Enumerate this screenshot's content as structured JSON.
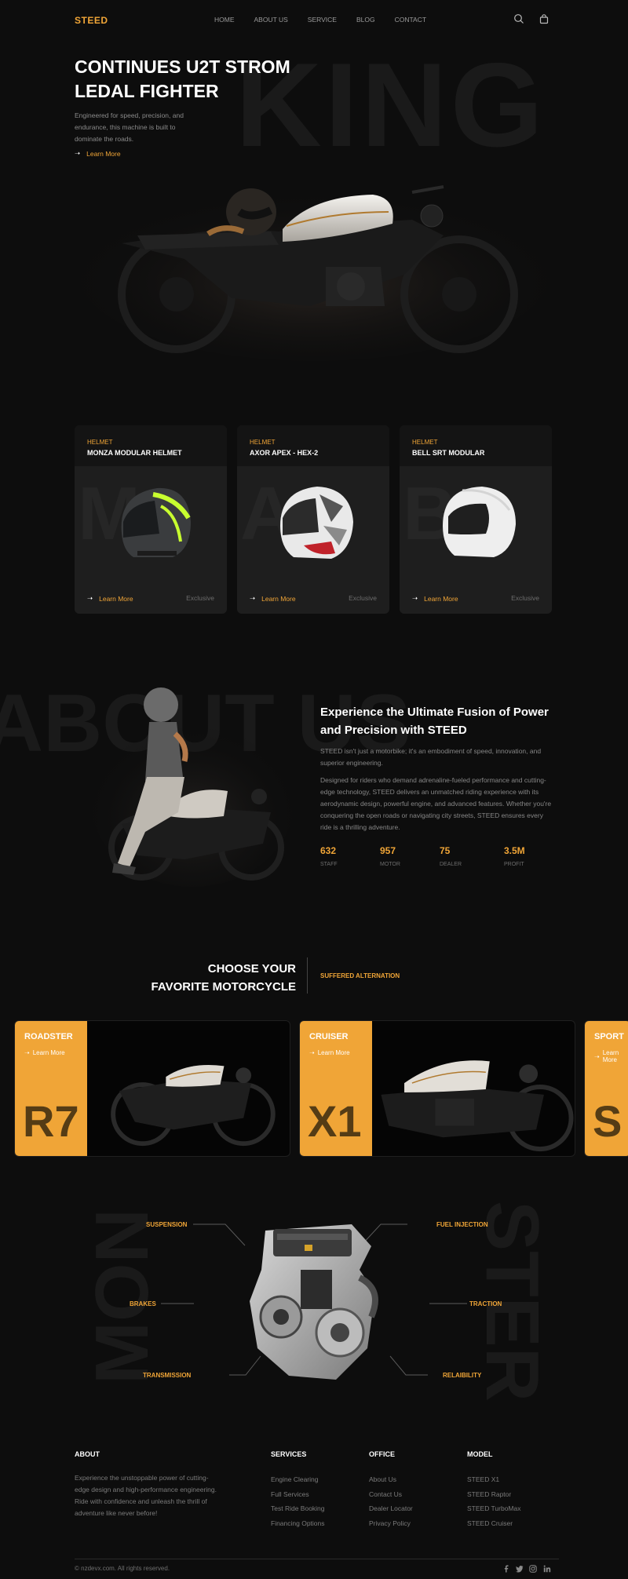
{
  "nav": {
    "logo": "STEED",
    "items": [
      "HOME",
      "ABOUT US",
      "SERVICE",
      "BLOG",
      "CONTACT"
    ],
    "icons": [
      "search-icon",
      "bag-icon"
    ]
  },
  "hero": {
    "watermark": "KING",
    "title": "CONTINUES U2T STROM LEDAL FIGHTER",
    "description": "Engineered for speed, precision, and endurance, this machine is built to dominate the roads.",
    "link": "Learn More"
  },
  "helmets": [
    {
      "category": "HELMET",
      "name": "MONZA MODULAR HELMET",
      "watermark": "M",
      "link": "Learn More",
      "tag": "Exclusive"
    },
    {
      "category": "HELMET",
      "name": "AXOR APEX - HEX-2",
      "watermark": "A",
      "link": "Learn More",
      "tag": "Exclusive"
    },
    {
      "category": "HELMET",
      "name": "BELL SRT MODULAR",
      "watermark": "B",
      "link": "Learn More",
      "tag": "Exclusive"
    }
  ],
  "about": {
    "watermark": "ABOUT US",
    "title": "Experience the Ultimate Fusion of Power and Precision with STEED",
    "p1": "STEED isn't just a motorbike; it's an embodiment of speed, innovation, and superior engineering.",
    "p2": "Designed for riders who demand adrenaline-fueled performance and cutting-edge technology, STEED delivers an unmatched riding experience with its aerodynamic design, powerful engine, and advanced features. Whether you're conquering the open roads or navigating city streets, STEED ensures every ride is a thrilling adventure.",
    "stats": [
      {
        "value": "632",
        "label": "STAFF"
      },
      {
        "value": "957",
        "label": "MOTOR"
      },
      {
        "value": "75",
        "label": "DEALER"
      },
      {
        "value": "3.5M",
        "label": "PROFIT"
      }
    ]
  },
  "choose": {
    "title_line1": "CHOOSE YOUR",
    "title_line2": "FAVORITE MOTORCYCLE",
    "subtitle": "SUFFERED ALTERNATION",
    "motorcycles": [
      {
        "type": "ROADSTER",
        "link": "Learn More",
        "code": "R7"
      },
      {
        "type": "CRUISER",
        "link": "Learn More",
        "code": "X1"
      },
      {
        "type": "SPORT",
        "link": "Learn More",
        "code": "S"
      }
    ]
  },
  "engine": {
    "watermark_left": "MON",
    "watermark_right": "STER",
    "labels": {
      "suspension": "SUSPENSION",
      "fuel_injection": "FUEL INJECTION",
      "brakes": "BRAKES",
      "traction": "TRACTION",
      "transmission": "TRANSMISSION",
      "reliability": "RELAIBILITY"
    }
  },
  "footer": {
    "about_heading": "ABOUT",
    "about_text": "Experience the unstoppable power of cutting-edge design and high-performance engineering. Ride with confidence and unleash the thrill of adventure like never before!",
    "services_heading": "SERVICES",
    "services": [
      "Engine Clearing",
      "Full Services",
      "Test Ride Booking",
      "Financing Options"
    ],
    "office_heading": "OFFICE",
    "office": [
      "About Us",
      "Contact Us",
      "Dealer Locator",
      "Privacy Policy"
    ],
    "model_heading": "MODEL",
    "models": [
      "STEED X1",
      "STEED Raptor",
      "STEED TurboMax",
      "STEED Cruiser"
    ],
    "copyright": "© nzdevx.com. All rights reserved.",
    "social_icons": [
      "facebook-icon",
      "twitter-icon",
      "instagram-icon",
      "linkedin-icon"
    ]
  },
  "colors": {
    "accent": "#f0a537",
    "background": "#0d0d0d",
    "card": "#1e1e1e"
  }
}
